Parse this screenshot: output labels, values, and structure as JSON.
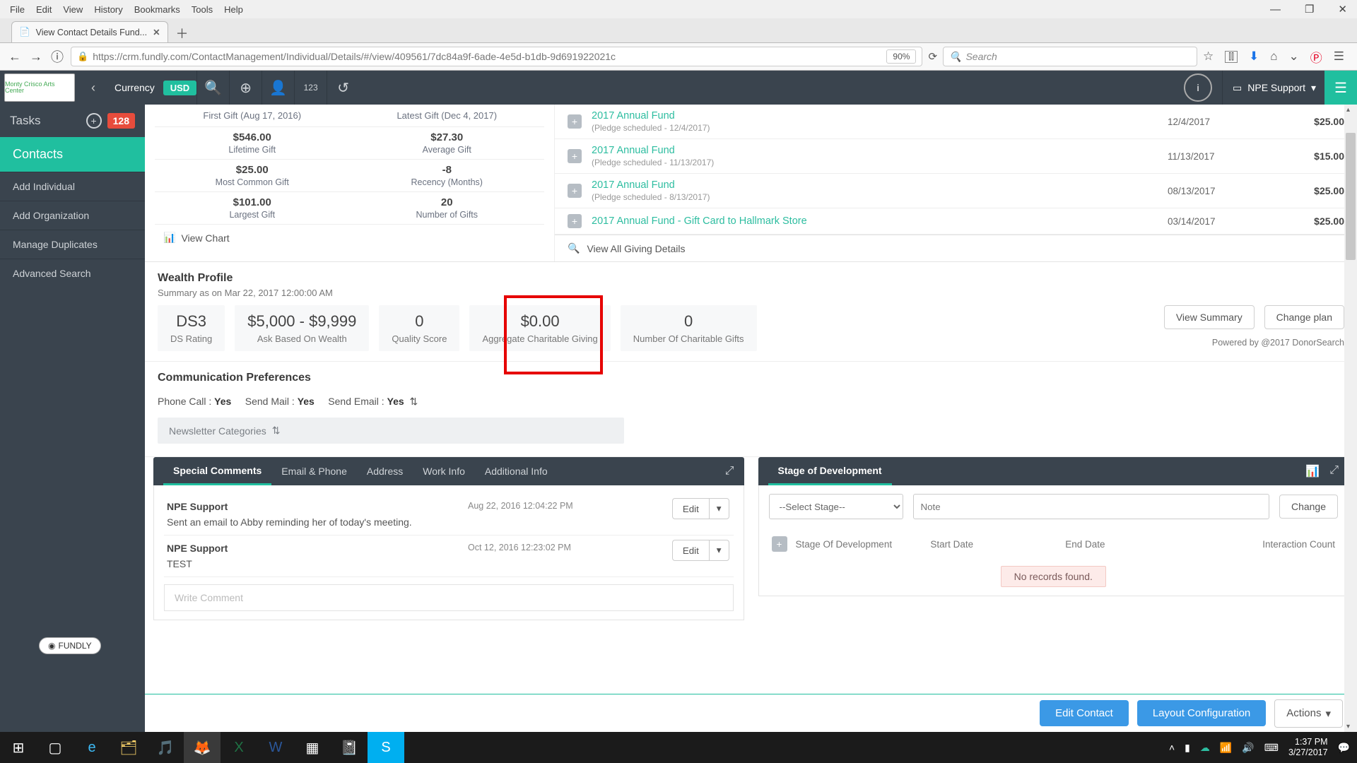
{
  "win_menu": [
    "File",
    "Edit",
    "View",
    "History",
    "Bookmarks",
    "Tools",
    "Help"
  ],
  "tab_title": "View Contact Details Fund...",
  "url_display": "https://crm.fundly.com/ContactManagement/Individual/Details/#/view/409561/7dc84a9f-6ade-4e5d-b1db-9d691922021c",
  "zoom": "90%",
  "search_placeholder": "Search",
  "topbar": {
    "org_name": "Monty Crisco Arts Center",
    "currency_label": "Currency",
    "currency_badge": "USD",
    "user_label": "NPE Support"
  },
  "sidebar": {
    "tasks_label": "Tasks",
    "tasks_count": "128",
    "active": "Contacts",
    "items": [
      "Add Individual",
      "Add Organization",
      "Manage Duplicates",
      "Advanced Search"
    ],
    "fundly_badge": "FUNDLY"
  },
  "gift_stats": {
    "header": {
      "first": "First Gift (Aug 17, 2016)",
      "latest": "Latest Gift (Dec 4, 2017)"
    },
    "cells": [
      {
        "val": "$546.00",
        "lab": "Lifetime Gift"
      },
      {
        "val": "$27.30",
        "lab": "Average Gift"
      },
      {
        "val": "$25.00",
        "lab": "Most Common Gift"
      },
      {
        "val": "-8",
        "lab": "Recency (Months)"
      },
      {
        "val": "$101.00",
        "lab": "Largest Gift"
      },
      {
        "val": "20",
        "lab": "Number of Gifts"
      }
    ],
    "view_chart": "View Chart"
  },
  "giving": {
    "rows": [
      {
        "fund": "2017 Annual Fund",
        "sub": "(Pledge scheduled - 12/4/2017)",
        "date": "12/4/2017",
        "amt": "$25.00"
      },
      {
        "fund": "2017 Annual Fund",
        "sub": "(Pledge scheduled - 11/13/2017)",
        "date": "11/13/2017",
        "amt": "$15.00"
      },
      {
        "fund": "2017 Annual Fund",
        "sub": "(Pledge scheduled - 8/13/2017)",
        "date": "08/13/2017",
        "amt": "$25.00"
      },
      {
        "fund": "2017 Annual Fund - Gift Card to Hallmark Store",
        "sub": "",
        "date": "03/14/2017",
        "amt": "$25.00"
      }
    ],
    "view_all": "View All Giving Details"
  },
  "wealth": {
    "title": "Wealth Profile",
    "subtitle": "Summary as on Mar 22, 2017 12:00:00 AM",
    "boxes": [
      {
        "val": "DS3",
        "lab": "DS Rating"
      },
      {
        "val": "$5,000 - $9,999",
        "lab": "Ask Based On Wealth"
      },
      {
        "val": "0",
        "lab": "Quality Score"
      },
      {
        "val": "$0.00",
        "lab": "Aggregate Charitable Giving"
      },
      {
        "val": "0",
        "lab": "Number Of Charitable Gifts"
      }
    ],
    "btn_summary": "View Summary",
    "btn_plan": "Change plan",
    "powered": "Powered by @2017 DonorSearch"
  },
  "comm": {
    "title": "Communication Preferences",
    "phone_label": "Phone Call :",
    "phone_val": "Yes",
    "mail_label": "Send Mail :",
    "mail_val": "Yes",
    "email_label": "Send Email :",
    "email_val": "Yes",
    "dropdown": "Newsletter Categories"
  },
  "panel_tabs": [
    "Special Comments",
    "Email & Phone",
    "Address",
    "Work Info",
    "Additional Info"
  ],
  "comments": [
    {
      "author": "NPE Support",
      "time": "Aug 22, 2016 12:04:22 PM",
      "body": "Sent an email to Abby reminding her of today's meeting."
    },
    {
      "author": "NPE Support",
      "time": "Oct 12, 2016 12:23:02 PM",
      "body": "TEST"
    }
  ],
  "edit_label": "Edit",
  "write_placeholder": "Write Comment",
  "stage": {
    "title": "Stage of Development",
    "select_placeholder": "--Select Stage--",
    "note_placeholder": "Note",
    "change": "Change",
    "cols": [
      "Stage Of Development",
      "Start Date",
      "End Date",
      "Interaction Count"
    ],
    "no_records": "No records found."
  },
  "actions": {
    "edit_contact": "Edit Contact",
    "layout": "Layout Configuration",
    "actions": "Actions"
  },
  "tray": {
    "time": "1:37 PM",
    "date": "3/27/2017"
  }
}
